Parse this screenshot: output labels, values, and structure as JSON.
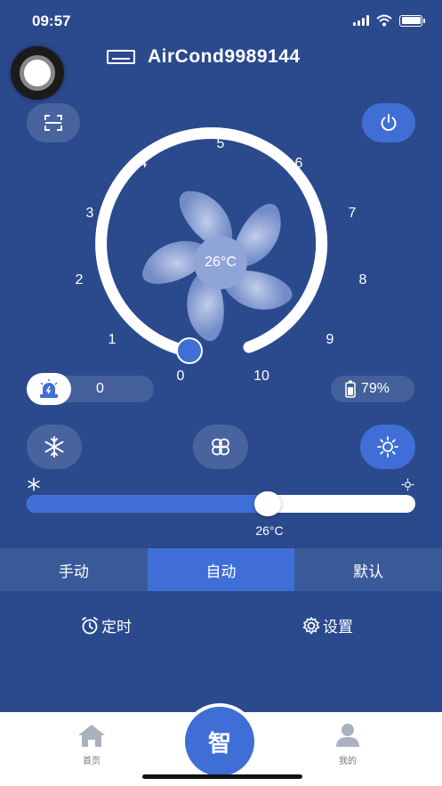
{
  "status_bar": {
    "time": "09:57"
  },
  "device": {
    "name": "AirCond9989144"
  },
  "dial": {
    "numbers": [
      "0",
      "1",
      "2",
      "3",
      "4",
      "5",
      "6",
      "7",
      "8",
      "9",
      "10"
    ],
    "center_temp": "26°C"
  },
  "info": {
    "alarm_count": "0",
    "battery": "79%"
  },
  "slider": {
    "value_label": "26°C",
    "fraction": 0.62
  },
  "tabs": [
    {
      "label": "手动"
    },
    {
      "label": "自动"
    },
    {
      "label": "默认"
    }
  ],
  "actions": {
    "timer_label": "定时",
    "settings_label": "设置"
  },
  "bottom_nav": {
    "home_label": "首页",
    "center_label": "智",
    "mine_label": "我的"
  },
  "colors": {
    "background": "#2b4a8e",
    "accent": "#3f6fd6"
  }
}
